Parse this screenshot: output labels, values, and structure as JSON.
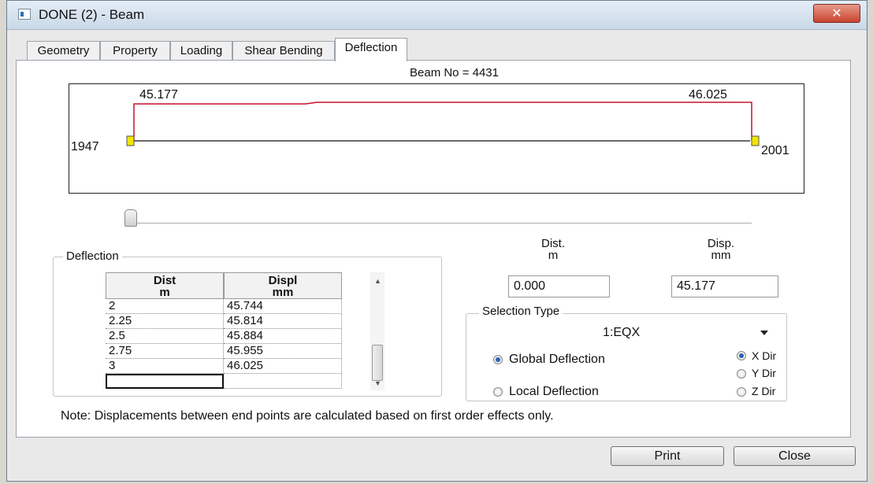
{
  "window": {
    "title": "DONE (2) - Beam",
    "close_glyph": "✕"
  },
  "tabs": [
    {
      "label": "Geometry",
      "active": false
    },
    {
      "label": "Property",
      "active": false
    },
    {
      "label": "Loading",
      "active": false
    },
    {
      "label": "Shear Bending",
      "active": false
    },
    {
      "label": "Deflection",
      "active": true
    }
  ],
  "beam": {
    "beam_no_text": "Beam No = 4431",
    "start_node": "1947",
    "end_node": "2001",
    "start_deflection": "45.177",
    "end_deflection": "46.025",
    "colors": {
      "deflection_line": "#c8102e",
      "node_marker": "#f2e600",
      "beam_line": "#111111"
    }
  },
  "slider": {
    "position_fraction": 0.0
  },
  "deflection_group": {
    "legend": "Deflection",
    "columns": [
      {
        "title": "Dist",
        "unit": "m"
      },
      {
        "title": "Displ",
        "unit": "mm"
      }
    ],
    "rows": [
      {
        "dist": "2",
        "displ": "45.744"
      },
      {
        "dist": "2.25",
        "displ": "45.814"
      },
      {
        "dist": "2.5",
        "displ": "45.884"
      },
      {
        "dist": "2.75",
        "displ": "45.955"
      },
      {
        "dist": "3",
        "displ": "46.025"
      }
    ]
  },
  "readout": {
    "dist_label": "Dist.",
    "dist_unit": "m",
    "dist_value": "0.000",
    "disp_label": "Disp.",
    "disp_unit": "mm",
    "disp_value": "45.177"
  },
  "selection": {
    "legend": "Selection Type",
    "load_case": "1:EQX",
    "deflection_options": [
      {
        "label": "Global Deflection",
        "selected": true
      },
      {
        "label": "Local Deflection",
        "selected": false
      }
    ],
    "direction_options": [
      {
        "label": "X Dir",
        "selected": true
      },
      {
        "label": "Y Dir",
        "selected": false
      },
      {
        "label": "Z Dir",
        "selected": false
      }
    ]
  },
  "note": "Note: Displacements between end points are calculated based on first order effects only.",
  "buttons": {
    "print": "Print",
    "close": "Close"
  }
}
